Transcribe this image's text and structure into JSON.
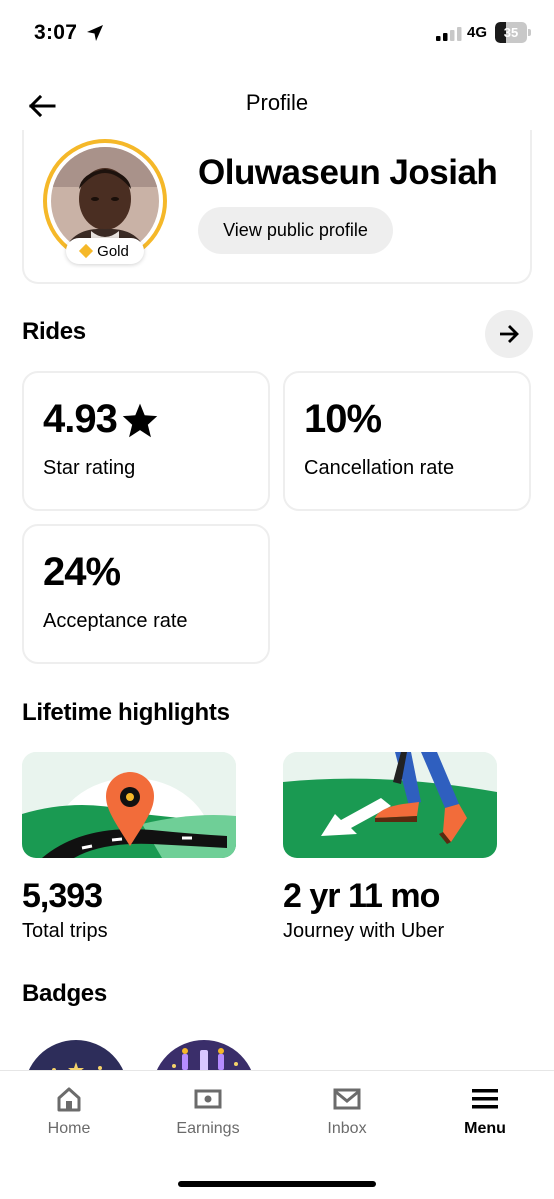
{
  "status_bar": {
    "time": "3:07",
    "network": "4G",
    "battery": "35",
    "battery_level": 0.35,
    "location_icon": "location-arrow-icon",
    "signal_icon": "cellular-signal-icon"
  },
  "header": {
    "title": "Profile",
    "back_icon": "arrow-left-icon"
  },
  "profile": {
    "name": "Oluwaseun Josiah",
    "public_profile_label": "View public profile",
    "tier": "Gold",
    "tier_color": "#f5b829"
  },
  "rides": {
    "title": "Rides",
    "arrow_icon": "arrow-right-icon",
    "stats": [
      {
        "value": "4.93",
        "label": "Star rating",
        "icon": "star-icon"
      },
      {
        "value": "10%",
        "label": "Cancellation rate"
      },
      {
        "value": "24%",
        "label": "Acceptance rate"
      }
    ]
  },
  "highlights": {
    "title": "Lifetime highlights",
    "items": [
      {
        "value": "5,393",
        "label": "Total trips",
        "illustration": "map-pin-road-illustration"
      },
      {
        "value": "2 yr 11 mo",
        "label": "Journey with Uber",
        "illustration": "walking-arrow-illustration"
      }
    ]
  },
  "badges": {
    "title": "Badges"
  },
  "tab_bar": {
    "items": [
      {
        "label": "Home",
        "icon": "home-icon"
      },
      {
        "label": "Earnings",
        "icon": "earnings-icon"
      },
      {
        "label": "Inbox",
        "icon": "mail-icon"
      },
      {
        "label": "Menu",
        "icon": "menu-icon",
        "active": true
      }
    ]
  },
  "colors": {
    "uber_green": "#1a9a52",
    "pin_orange": "#f26c3a",
    "card_border": "#eeeeee",
    "badge_navy": "#2d2d5a"
  }
}
